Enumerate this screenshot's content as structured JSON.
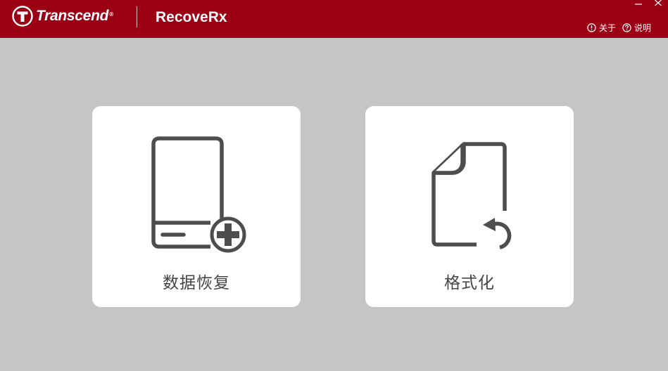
{
  "header": {
    "brand": "Transcend",
    "registered_mark": "®",
    "app_title": "RecoveRx",
    "about_label": "关于",
    "help_label": "说明",
    "background_color": "#9b0014"
  },
  "window_controls": {
    "minimize_icon": "minimize-icon",
    "close_icon": "close-icon"
  },
  "main": {
    "background_color": "#c5c5c5",
    "cards": [
      {
        "label": "数据恢复",
        "icon": "drive-add-icon"
      },
      {
        "label": "格式化",
        "icon": "document-refresh-icon"
      }
    ]
  }
}
